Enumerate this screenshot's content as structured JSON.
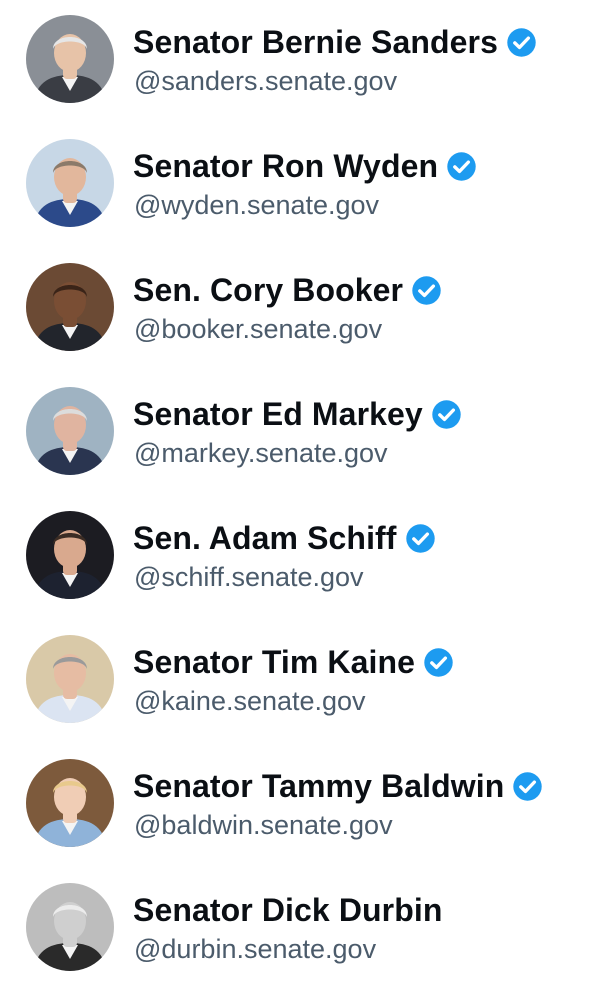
{
  "accounts": [
    {
      "name": "Senator Bernie Sanders",
      "handle": "@sanders.senate.gov",
      "verified": true,
      "avatar": {
        "bg": "#8a8f96",
        "skin": "#e7c3a8",
        "hair": "#e6e6e6",
        "suit": "#3a3d44"
      }
    },
    {
      "name": "Senator Ron Wyden",
      "handle": "@wyden.senate.gov",
      "verified": true,
      "avatar": {
        "bg": "#c7d7e6",
        "skin": "#e2b79c",
        "hair": "#8b7a6a",
        "suit": "#2c4a8a"
      }
    },
    {
      "name": "Sen. Cory Booker",
      "handle": "@booker.senate.gov",
      "verified": true,
      "avatar": {
        "bg": "#6b4a34",
        "skin": "#7a4e34",
        "hair": "#3a2418",
        "suit": "#22252c"
      }
    },
    {
      "name": "Senator Ed Markey",
      "handle": "@markey.senate.gov",
      "verified": true,
      "avatar": {
        "bg": "#9fb3c2",
        "skin": "#e0b4a0",
        "hair": "#dcdcdc",
        "suit": "#2a3550"
      }
    },
    {
      "name": "Sen. Adam Schiff",
      "handle": "@schiff.senate.gov",
      "verified": true,
      "avatar": {
        "bg": "#1c1c22",
        "skin": "#d9a98e",
        "hair": "#3b2c24",
        "suit": "#1d2230"
      }
    },
    {
      "name": "Senator Tim Kaine",
      "handle": "@kaine.senate.gov",
      "verified": true,
      "avatar": {
        "bg": "#d9c9a8",
        "skin": "#e6bca3",
        "hair": "#9a9a9a",
        "suit": "#dbe4f2"
      }
    },
    {
      "name": "Senator Tammy Baldwin",
      "handle": "@baldwin.senate.gov",
      "verified": true,
      "avatar": {
        "bg": "#7d5a3c",
        "skin": "#f0cdb5",
        "hair": "#e8c98c",
        "suit": "#8fb3d9"
      }
    },
    {
      "name": "Senator Dick Durbin",
      "handle": "@durbin.senate.gov",
      "verified": false,
      "avatar": {
        "bg": "#bdbdbd",
        "skin": "#cfcfcf",
        "hair": "#ececec",
        "suit": "#2a2a2a"
      }
    }
  ],
  "colors": {
    "verified_badge": "#1d9bf0",
    "name_text": "#0b0f14",
    "handle_text": "#4b5b6b",
    "background": "#ffffff"
  },
  "icons": {
    "verified": "verified-check-icon"
  }
}
